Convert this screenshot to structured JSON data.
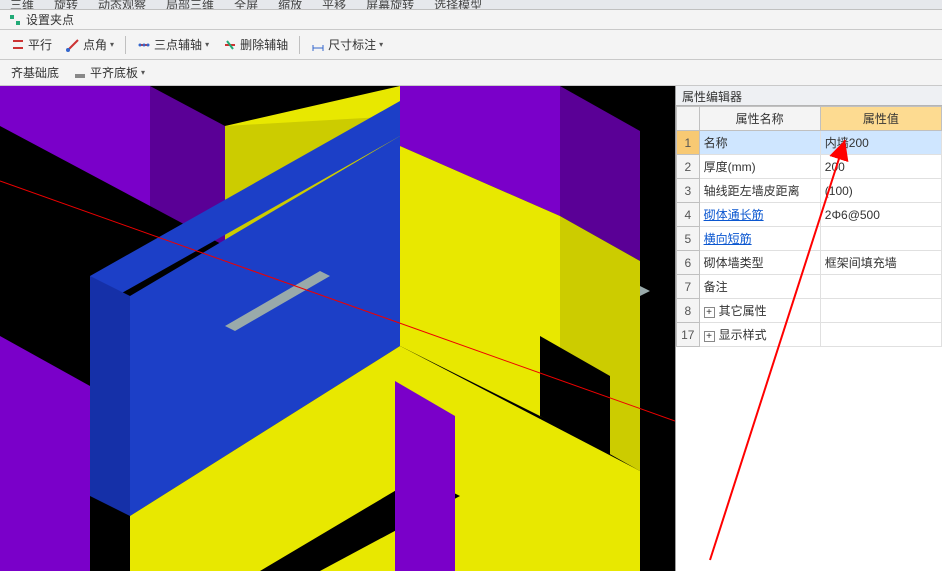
{
  "top_strip": {
    "items": [
      "三维   ",
      "旋转",
      "动态观察",
      "局部三维",
      "全屏",
      "缩放",
      "平移",
      "屏幕旋转",
      "选择模型"
    ]
  },
  "row2": {
    "label": "设置夹点"
  },
  "toolbar": [
    {
      "label": "平行"
    },
    {
      "label": "点角"
    },
    {
      "label": "三点辅轴"
    },
    {
      "label": "删除辅轴"
    },
    {
      "label": "尺寸标注"
    }
  ],
  "row4": [
    {
      "label": "齐基础底"
    },
    {
      "label": "平齐底板"
    }
  ],
  "panel": {
    "title": "属性编辑器",
    "headers": {
      "name": "属性名称",
      "value": "属性值"
    },
    "rows": [
      {
        "n": "1",
        "name": "名称",
        "value": "内墙200",
        "link": false,
        "sel": true
      },
      {
        "n": "2",
        "name": "厚度(mm)",
        "value": "200",
        "link": false
      },
      {
        "n": "3",
        "name": "轴线距左墙皮距离",
        "value": "(100)",
        "link": false
      },
      {
        "n": "4",
        "name": "砌体通长筋",
        "value": "2Φ6@500",
        "link": true
      },
      {
        "n": "5",
        "name": "横向短筋",
        "value": "",
        "link": true
      },
      {
        "n": "6",
        "name": "砌体墙类型",
        "value": "框架间填充墙",
        "link": false
      },
      {
        "n": "7",
        "name": "备注",
        "value": "",
        "link": false
      },
      {
        "n": "8",
        "name": "其它属性",
        "value": "",
        "exp": true
      },
      {
        "n": "17",
        "name": "显示样式",
        "value": "",
        "exp": true
      }
    ]
  }
}
